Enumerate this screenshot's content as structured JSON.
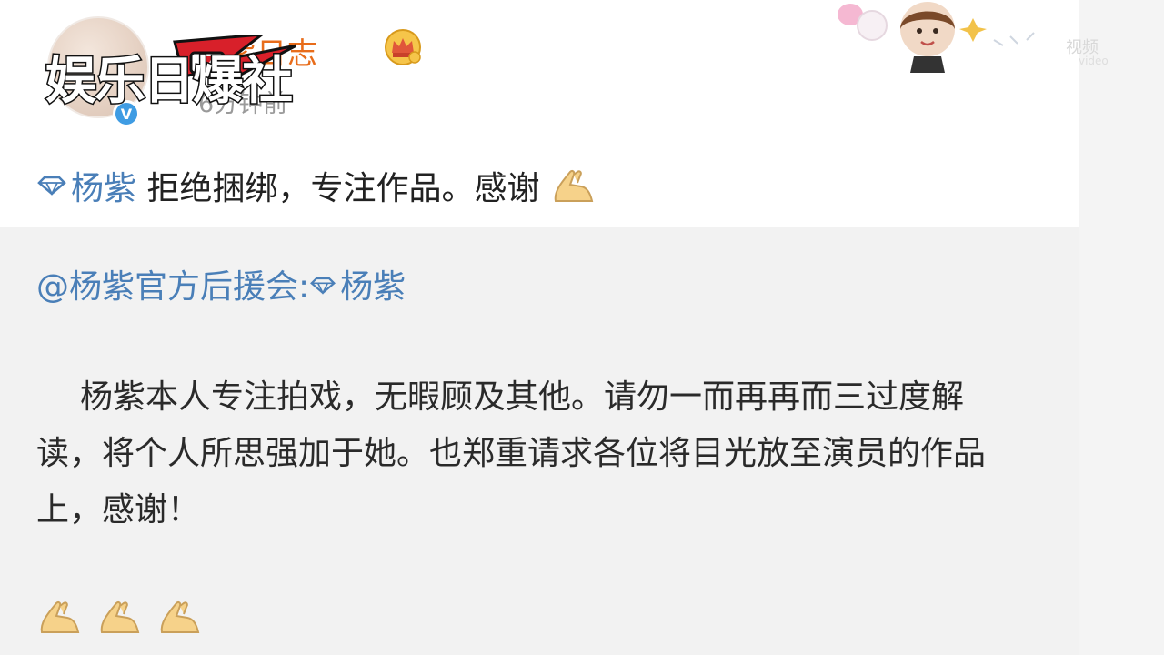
{
  "post": {
    "username": "杨紫日志",
    "time": "6分钟前",
    "status": {
      "tag": "杨紫",
      "text": " 拒绝捆绑，专注作品。感谢"
    }
  },
  "repost": {
    "source": "@杨紫官方后援会:",
    "tag": "杨紫",
    "body": "杨紫本人专注拍戏，无暇顾及其他。请勿一而再再而三过度解读，将个人所思强加于她。也郑重请求各位将目光放至演员的作品上，感谢！",
    "emoji_count": 3
  },
  "logo": {
    "text": "娱乐日爆社"
  },
  "watermark": {
    "text": "视频",
    "sub": "video"
  },
  "icons": {
    "verified": "verified-badge-icon",
    "crown": "crown-icon",
    "diamond": "diamond-icon",
    "hands": "praying-hands-icon"
  },
  "colors": {
    "username": "#e86c1a",
    "link": "#4a7fb8",
    "verified": "#3f9ce3",
    "logo_red": "#d8202a"
  }
}
